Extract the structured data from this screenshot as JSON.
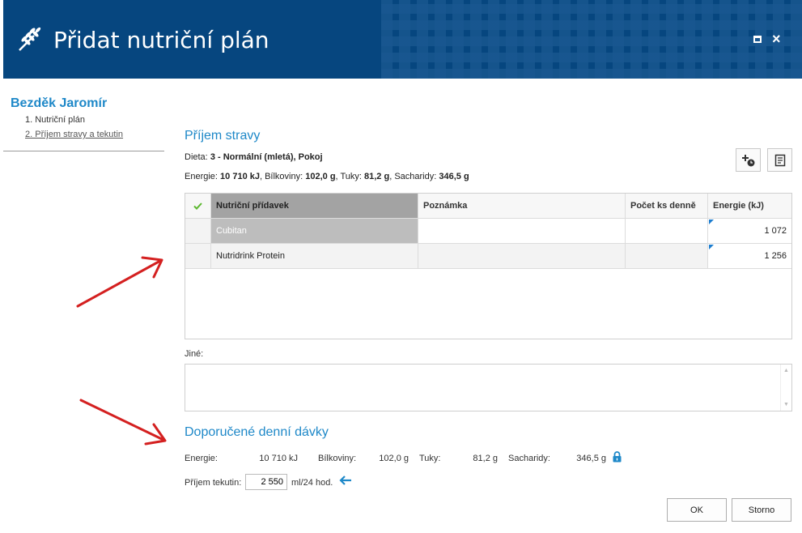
{
  "window": {
    "title": "Přidat nutriční plán",
    "maximize_icon": "maximize-icon",
    "close_label": "×"
  },
  "sidebar": {
    "patient_name": "Bezděk Jaromír",
    "steps": [
      {
        "label": "1. Nutriční plán"
      },
      {
        "label": "2. Příjem stravy a tekutin"
      }
    ]
  },
  "intake": {
    "title": "Příjem stravy",
    "diet_label": "Dieta:",
    "diet_value": "3 - Normální (mletá), Pokoj",
    "energy_label": "Energie:",
    "energy_value": "10 710 kJ",
    "protein_label": ", Bílkoviny:",
    "protein_value": "102,0 g",
    "fat_label": ", Tuky:",
    "fat_value": "81,2 g",
    "carbs_label": ", Sacharidy:",
    "carbs_value": "346,5 g"
  },
  "grid": {
    "columns": [
      "Nutriční přídavek",
      "Poznámka",
      "Počet ks denně",
      "Energie (kJ)"
    ],
    "rows": [
      {
        "name": "Cubitan",
        "note": "",
        "count": "",
        "energy": "1 072"
      },
      {
        "name": "Nutridrink Protein",
        "note": "",
        "count": "",
        "energy": "1 256"
      }
    ]
  },
  "other": {
    "label": "Jiné:"
  },
  "recommended": {
    "title": "Doporučené denní dávky",
    "energy_label": "Energie:",
    "energy_value": "10 710 kJ",
    "protein_label": "Bílkoviny:",
    "protein_value": "102,0 g",
    "fat_label": "Tuky:",
    "fat_value": "81,2 g",
    "carbs_label": "Sacharidy:",
    "carbs_value": "346,5 g",
    "fluid_label": "Příjem tekutin:",
    "fluid_value": "2 550",
    "fluid_unit": "ml/24 hod."
  },
  "buttons": {
    "ok": "OK",
    "cancel": "Storno"
  },
  "colors": {
    "titlebar": "#06467f",
    "accent": "#1e88c8",
    "annotation": "#d42020"
  }
}
